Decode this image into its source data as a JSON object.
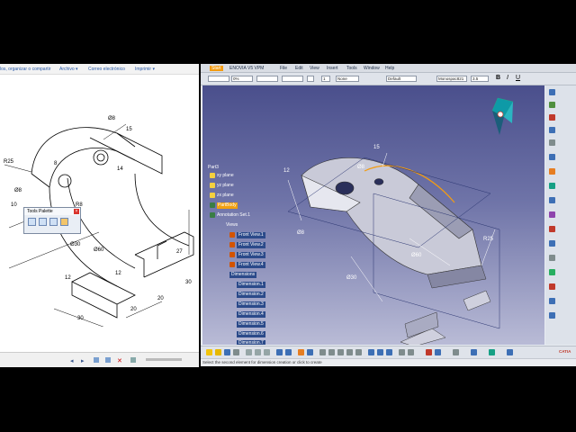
{
  "left_window": {
    "menu": [
      "los, organizar o compartir",
      "Archivo ▾",
      "Correo electrónico",
      "Imprimir ▾"
    ],
    "tools_palette": {
      "title": "Tools Palette",
      "close": "×"
    },
    "drawing_labels": {
      "r25": "R25",
      "r8": "R8",
      "d8a": "Ø8",
      "d8b": "Ø8",
      "d60": "Ø60",
      "d30": "Ø30",
      "dim15": "15",
      "dim20a": "20",
      "dim27": "27",
      "dim12a": "12",
      "dim12b": "12",
      "dim30a": "30",
      "dim30b": "30",
      "dim20b": "20",
      "dim8": "8",
      "dim14": "14",
      "dim10": "10"
    }
  },
  "right_window": {
    "menu": [
      "Start",
      "ENOVIA V5 VPM",
      "File",
      "Edit",
      "View",
      "Insert",
      "Tools",
      "Window",
      "Help"
    ],
    "toolbar_fields": [
      "0%",
      "1",
      "None",
      "Default",
      "Monospac821",
      "3.5"
    ],
    "tree": {
      "root": "Part3",
      "planes": [
        "xy plane",
        "yz plane",
        "zx plane"
      ],
      "partbody": "PartBody",
      "annotation_set": "Annotation Set.1",
      "views": "Views",
      "view_items": [
        "Front View.1",
        "Front View.2",
        "Front View.3",
        "Front View.4"
      ],
      "dimensions": "Dimensions",
      "dimension_items": [
        "Dimension.1",
        "Dimension.2",
        "Dimension.3",
        "Dimension.4",
        "Dimension.5",
        "Dimension.6",
        "Dimension.7"
      ]
    },
    "model_labels": {
      "d8a": "Ø8",
      "d8b": "Ø8",
      "d30": "Ø30",
      "d60": "Ø60",
      "r25": "R25",
      "dim12": "12",
      "dim15": "15"
    },
    "status": "Select the second element for dimension creation or click to create",
    "catia_logo": "CATIA"
  }
}
